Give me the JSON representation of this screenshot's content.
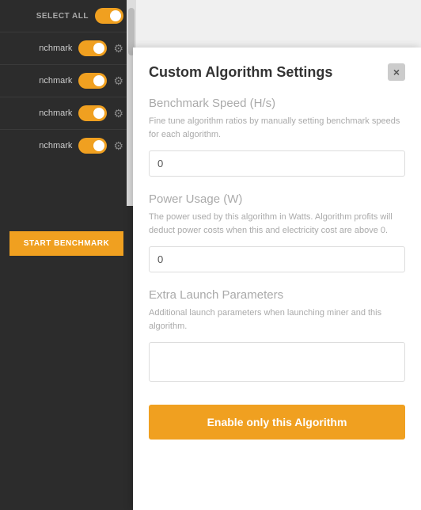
{
  "leftPanel": {
    "selectAll": "SELECT ALL",
    "algorithms": [
      {
        "name": "nchmark",
        "enabled": true
      },
      {
        "name": "nchmark",
        "enabled": true
      },
      {
        "name": "nchmark",
        "enabled": true
      },
      {
        "name": "nchmark",
        "enabled": true
      }
    ],
    "benchmarkButton": "START BENCHMARK"
  },
  "modal": {
    "title": "Custom Algorithm Settings",
    "closeLabel": "×",
    "sections": [
      {
        "id": "benchmark-speed",
        "title": "Benchmark Speed (H/s)",
        "description": "Fine tune algorithm ratios by manually setting benchmark speeds for each algorithm.",
        "inputValue": "0",
        "inputPlaceholder": ""
      },
      {
        "id": "power-usage",
        "title": "Power Usage (W)",
        "description": "The power used by this algorithm in Watts. Algorithm profits will deduct power costs when this and electricity cost are above 0.",
        "inputValue": "0",
        "inputPlaceholder": ""
      },
      {
        "id": "extra-params",
        "title": "Extra Launch Parameters",
        "description": "Additional launch parameters when launching miner and this algorithm.",
        "inputValue": "",
        "inputPlaceholder": ""
      }
    ],
    "enableButton": "Enable only this Algorithm"
  }
}
